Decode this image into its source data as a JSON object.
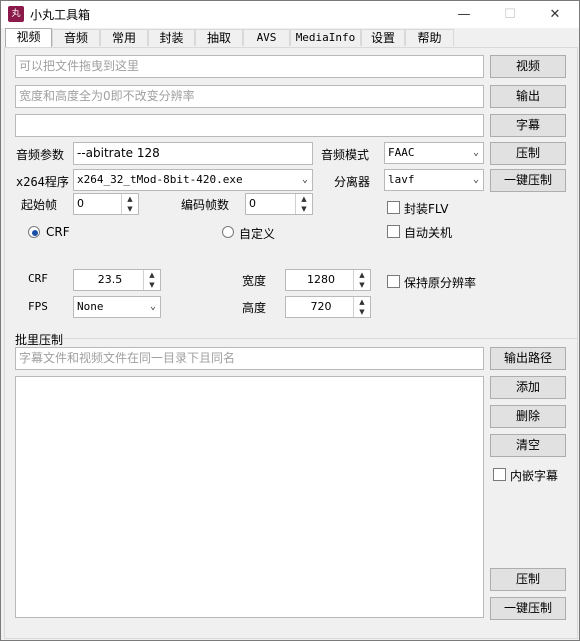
{
  "window": {
    "title": "小丸工具箱",
    "icon_text": "丸",
    "icon_color": "#8b1a4a",
    "minimize": "—",
    "maximize": "☐",
    "close": "✕"
  },
  "tabs": [
    "视频",
    "音频",
    "常用",
    "封装",
    "抽取",
    "AVS",
    "MediaInfo",
    "设置",
    "帮助"
  ],
  "video": {
    "drop_placeholder": "可以把文件拖曳到这里",
    "size_placeholder": "宽度和高度全为0即不改变分辨率",
    "subtitle_path": "",
    "btn_video": "视频",
    "btn_output": "输出",
    "btn_subtitle": "字幕",
    "btn_compress": "压制",
    "btn_oneclick": "一键压制",
    "audio_params_label": "音频参数",
    "audio_params_value": "--abitrate 128",
    "audio_mode_label": "音频模式",
    "audio_mode_value": "FAAC",
    "x264_label": "x264程序",
    "x264_value": "x264_32_tMod-8bit-420.exe",
    "splitter_label": "分离器",
    "splitter_value": "lavf",
    "start_frame_label": "起始帧",
    "start_frame_value": "0",
    "encode_frames_label": "编码帧数",
    "encode_frames_value": "0",
    "encap_flv_label": "封装FLV",
    "auto_shutdown_label": "自动关机",
    "crf_radio_label": "CRF",
    "custom_radio_label": "自定义",
    "crf_label": "CRF",
    "crf_value": "23.5",
    "fps_label": "FPS",
    "fps_value": "None",
    "width_label": "宽度",
    "width_value": "1280",
    "height_label": "高度",
    "height_value": "720",
    "keep_res_label": "保持原分辨率"
  },
  "batch": {
    "title": "批里压制",
    "placeholder": "字幕文件和视频文件在同一目录下且同名",
    "btn_output_path": "输出路径",
    "btn_add": "添加",
    "btn_delete": "删除",
    "btn_clear": "清空",
    "embed_sub_label": "内嵌字幕",
    "btn_compress": "压制",
    "btn_oneclick": "一键压制"
  }
}
